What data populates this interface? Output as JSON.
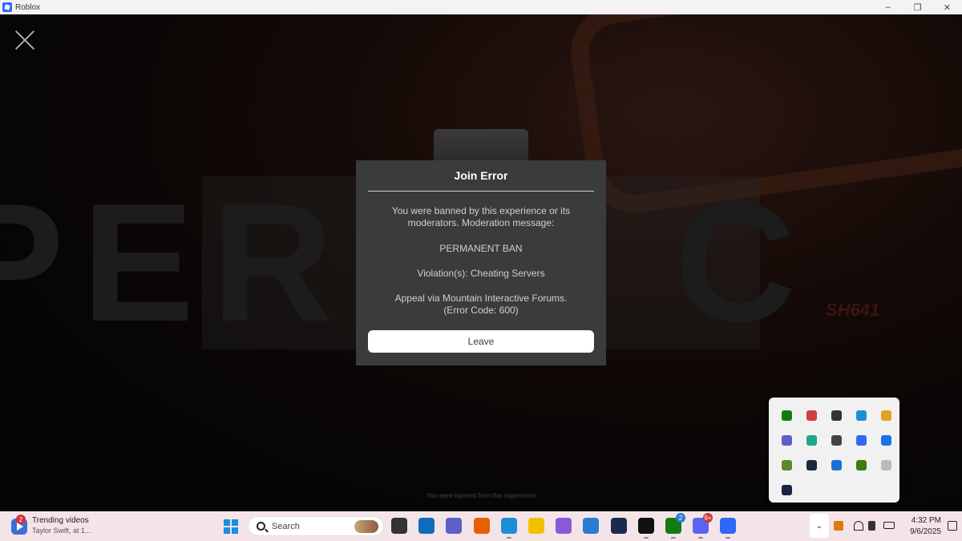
{
  "window": {
    "title": "Roblox",
    "controls": [
      "–",
      "❐",
      "✕"
    ]
  },
  "viewport": {
    "background_letters": "PER   S, C",
    "background_tag": "SH641",
    "footer_text": "You were banned from this experience"
  },
  "dialog": {
    "title": "Join Error",
    "message_line1": "You were banned by this experience or its moderators. Moderation message:",
    "ban_type": "PERMANENT BAN",
    "violation": "Violation(s): Cheating Servers",
    "appeal": "Appeal via Mountain Interactive Forums.",
    "error_code": "(Error Code: 600)",
    "leave_label": "Leave"
  },
  "tray_overflow": {
    "icons": [
      {
        "name": "xbox-icon",
        "color": "#107c10"
      },
      {
        "name": "discord-tray-icon",
        "color": "#d04040"
      },
      {
        "name": "pin-icon",
        "color": "#333333"
      },
      {
        "name": "edge-icon",
        "color": "#1b8fd6"
      },
      {
        "name": "bowtie-icon",
        "color": "#e0a020"
      },
      {
        "name": "teams-icon",
        "color": "#5b5fc7"
      },
      {
        "name": "screen-icon",
        "color": "#1aa88a"
      },
      {
        "name": "cloud-off-icon",
        "color": "#444444"
      },
      {
        "name": "g-app-icon",
        "color": "#2f67f6"
      },
      {
        "name": "bluetooth-icon",
        "color": "#1a73e8"
      },
      {
        "name": "minecraft-icon",
        "color": "#5a8a2a"
      },
      {
        "name": "steam-icon",
        "color": "#1b2838"
      },
      {
        "name": "defender-icon",
        "color": "#1a6fd6"
      },
      {
        "name": "nvidia-icon",
        "color": "#3a7d0c"
      },
      {
        "name": "device-icon",
        "color": "#bbbbbb"
      },
      {
        "name": "app-dark-icon",
        "color": "#1c2340"
      }
    ]
  },
  "taskbar": {
    "widget": {
      "badge": "2",
      "title": "Trending videos",
      "subtitle": "Taylor Swift, at 1..."
    },
    "search_placeholder": "Search",
    "apps": [
      {
        "name": "taskview-icon",
        "color": "#333333",
        "running": false
      },
      {
        "name": "outlook-icon",
        "color": "#0f6cbd",
        "running": false
      },
      {
        "name": "teams-taskbar-icon",
        "color": "#5b5fc7",
        "running": false
      },
      {
        "name": "firefox-icon",
        "color": "#e66000",
        "running": false
      },
      {
        "name": "edge-taskbar-icon",
        "color": "#1b8fd6",
        "running": true
      },
      {
        "name": "file-explorer-icon",
        "color": "#f2c200",
        "running": false
      },
      {
        "name": "pc-manager-icon",
        "color": "#8a5ad6",
        "running": false
      },
      {
        "name": "store-icon",
        "color": "#2b7bd6",
        "running": false
      },
      {
        "name": "app-m-icon",
        "color": "#1a2a4a",
        "running": false
      },
      {
        "name": "epic-app-icon",
        "color": "#111111",
        "running": true
      },
      {
        "name": "xbox-taskbar-icon",
        "color": "#107c10",
        "running": true,
        "badge": "2"
      },
      {
        "name": "discord-icon",
        "color": "#5865f2",
        "running": true,
        "badge": "9+"
      },
      {
        "name": "roblox-icon",
        "color": "#2f67f6",
        "running": true
      }
    ],
    "tray_button": "⌄",
    "clock_time": "4:32 PM",
    "clock_date": "9/6/2025"
  }
}
